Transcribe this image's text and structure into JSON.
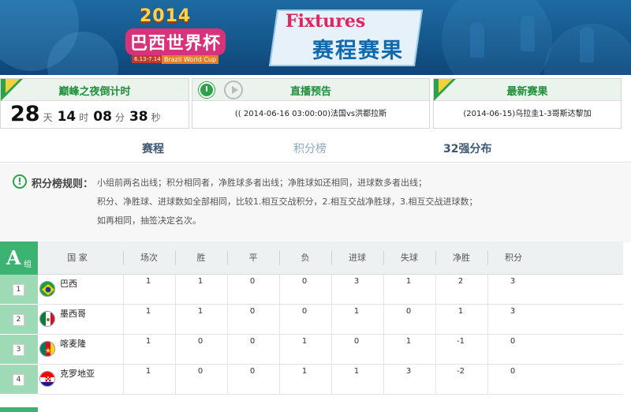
{
  "banner": {
    "logo_year": "2014",
    "logo_cn": "巴西世界杯",
    "logo_date": "6.13-7.14",
    "logo_en": "Brazil World Cup",
    "fixtures_en": "Fixtures",
    "fixtures_cn": "赛程赛果"
  },
  "countdown": {
    "title": "巅峰之夜倒计时",
    "days": "28",
    "days_unit": "天",
    "hours": "14",
    "hours_unit": "时",
    "minutes": "08",
    "minutes_unit": "分",
    "seconds": "38",
    "seconds_unit": "秒"
  },
  "live": {
    "title": "直播预告",
    "text": "(( 2014-06-16 03:00:00)法国vs洪都拉斯"
  },
  "latest": {
    "title": "最新赛果",
    "text": "(2014-06-15)乌拉圭1-3哥斯达黎加"
  },
  "tabs": [
    "赛程",
    "积分榜",
    "32强分布"
  ],
  "rules": {
    "title": "积分榜规则：",
    "lines": [
      "小组前两名出线；积分相同者，净胜球多者出线；净胜球如还相同，进球数多者出线；",
      "积分、净胜球、进球数如全部相同，比较1.相互交战积分，2.相互交战净胜球，3.相互交战进球数；",
      "如再相同，抽签决定名次。"
    ]
  },
  "group": {
    "letter": "A",
    "suffix": "组",
    "headers": [
      "国 家",
      "场次",
      "胜",
      "平",
      "负",
      "进球",
      "失球",
      "净胜",
      "积分"
    ],
    "rows": [
      {
        "rank": "1",
        "team": "巴西",
        "played": "1",
        "win": "1",
        "draw": "0",
        "loss": "0",
        "gf": "3",
        "ga": "1",
        "gd": "2",
        "pts": "3"
      },
      {
        "rank": "2",
        "team": "墨西哥",
        "played": "1",
        "win": "1",
        "draw": "0",
        "loss": "0",
        "gf": "1",
        "ga": "0",
        "gd": "1",
        "pts": "3"
      },
      {
        "rank": "3",
        "team": "喀麦隆",
        "played": "1",
        "win": "0",
        "draw": "0",
        "loss": "1",
        "gf": "0",
        "ga": "1",
        "gd": "-1",
        "pts": "0"
      },
      {
        "rank": "4",
        "team": "克罗地亚",
        "played": "1",
        "win": "0",
        "draw": "0",
        "loss": "1",
        "gf": "1",
        "ga": "3",
        "gd": "-2",
        "pts": "0"
      }
    ]
  },
  "colors": {
    "accent_green": "#2aa34a",
    "group_green": "#3cb371",
    "banner_blue": "#14568a",
    "fixtures_pink": "#e0245e"
  }
}
